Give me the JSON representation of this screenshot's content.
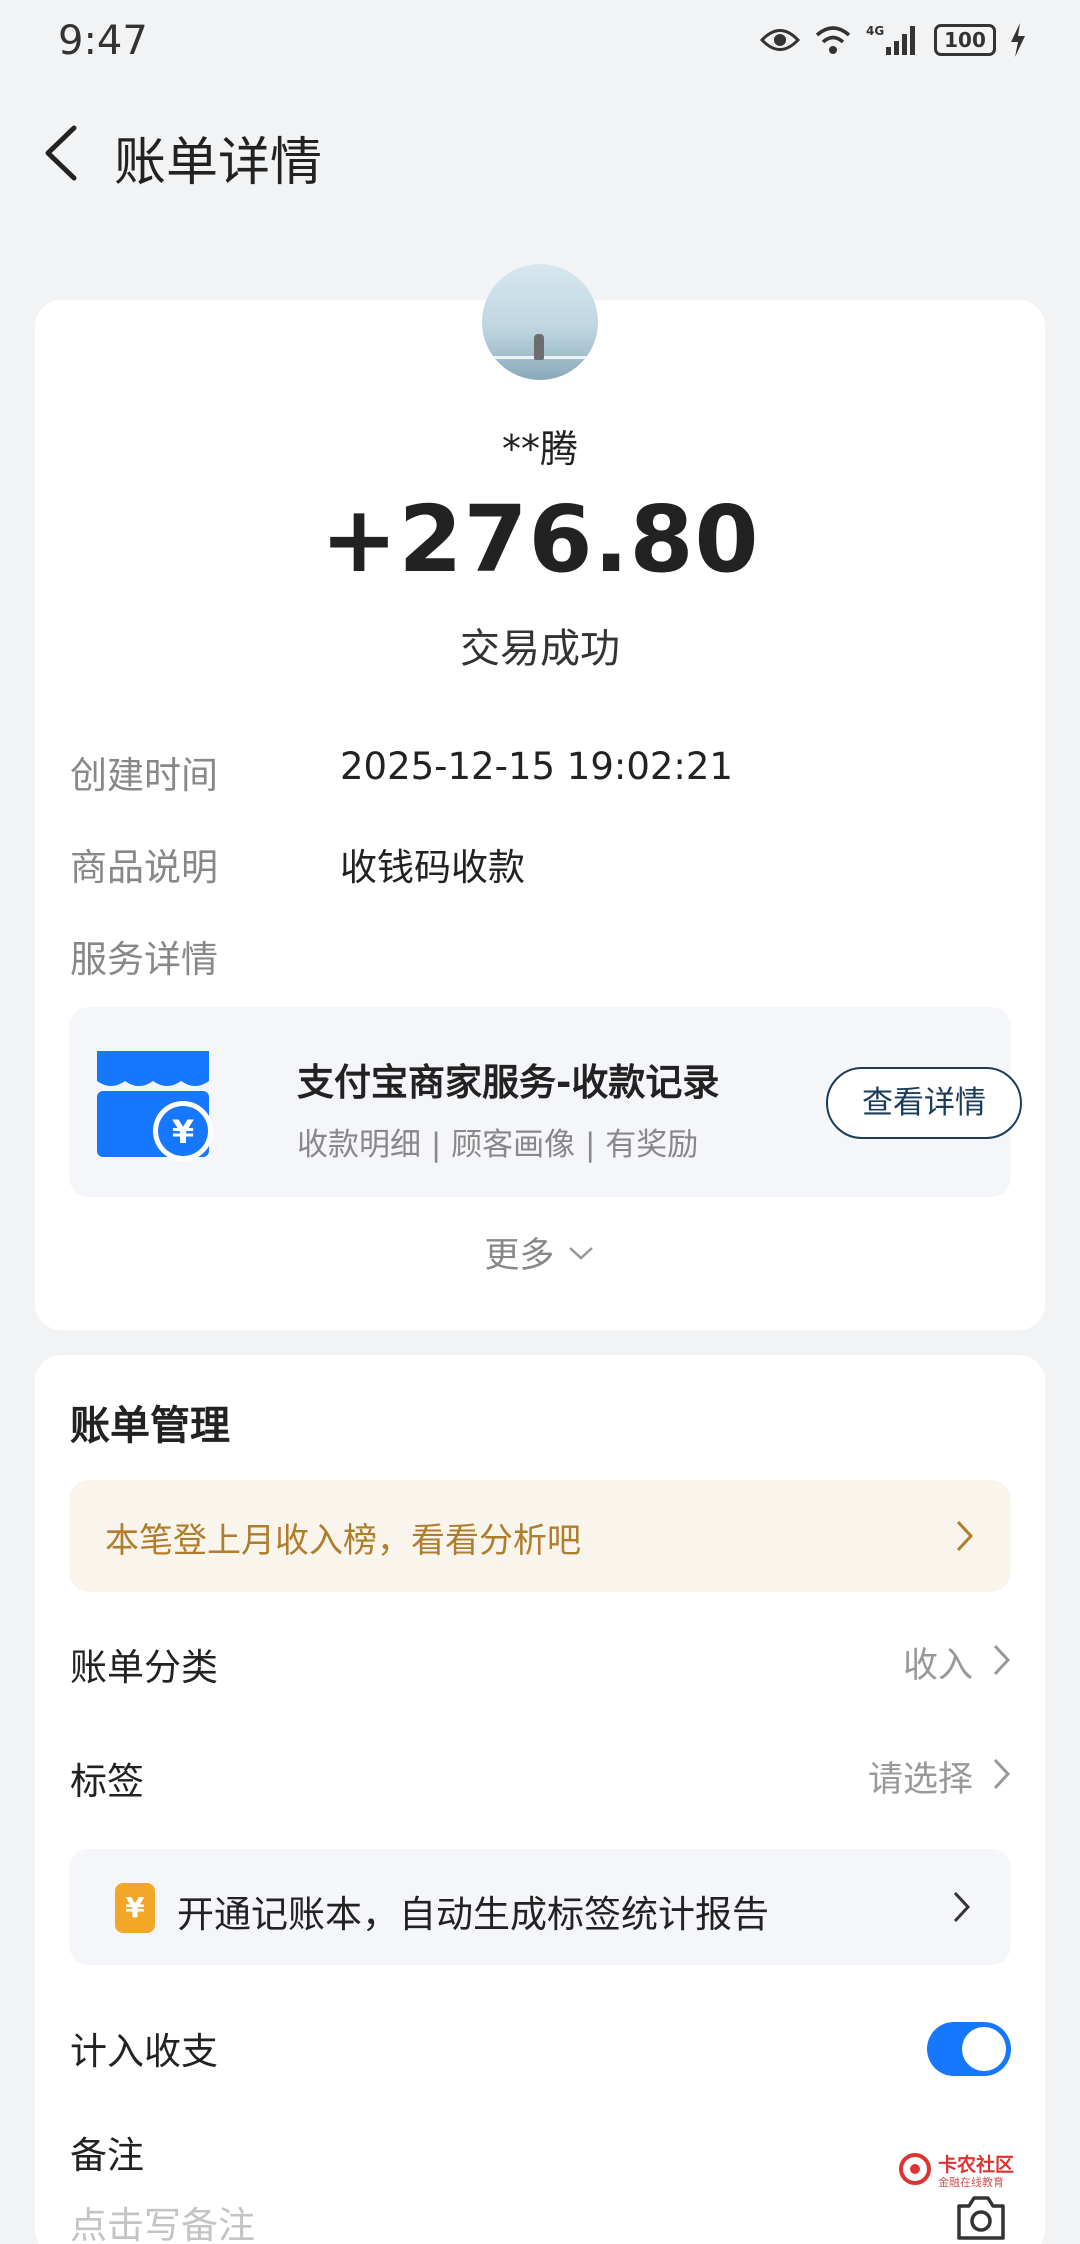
{
  "status_bar": {
    "time": "9:47",
    "battery": "100",
    "network": "4G",
    "icons": [
      "eye-icon",
      "wifi-icon",
      "signal-icon",
      "battery-icon",
      "charging-icon"
    ]
  },
  "nav": {
    "title": "账单详情",
    "back_icon": "chevron-left-icon"
  },
  "transaction": {
    "payer": "**腾",
    "amount": "+276.80",
    "status": "交易成功",
    "rows": [
      {
        "label": "创建时间",
        "value": "2025-12-15 19:02:21"
      },
      {
        "label": "商品说明",
        "value": "收钱码收款"
      }
    ],
    "service_label": "服务详情",
    "service": {
      "title": "支付宝商家服务-收款记录",
      "subtitle": "收款明细 | 顾客画像 | 有奖励",
      "button": "查看详情",
      "icon": "storefront-yuan-icon"
    },
    "more": "更多"
  },
  "bill_management": {
    "title": "账单管理",
    "promo": "本笔登上月收入榜，看看分析吧",
    "category_label": "账单分类",
    "category_value": "收入",
    "tag_label": "标签",
    "tag_value": "请选择",
    "ledger_promo": "开通记账本，自动生成标签统计报告",
    "ledger_icon_glyph": "¥",
    "include_label": "计入收支",
    "include_enabled": true,
    "note_label": "备注",
    "note_placeholder": "点击写备注"
  },
  "watermark": {
    "title": "卡农社区",
    "subtitle": "金融在线教育"
  },
  "colors": {
    "background": "#f2f3f5",
    "accent_blue": "#1677ff",
    "promo_gold": "#b07d2c",
    "icon_blue": "#1677ff"
  }
}
